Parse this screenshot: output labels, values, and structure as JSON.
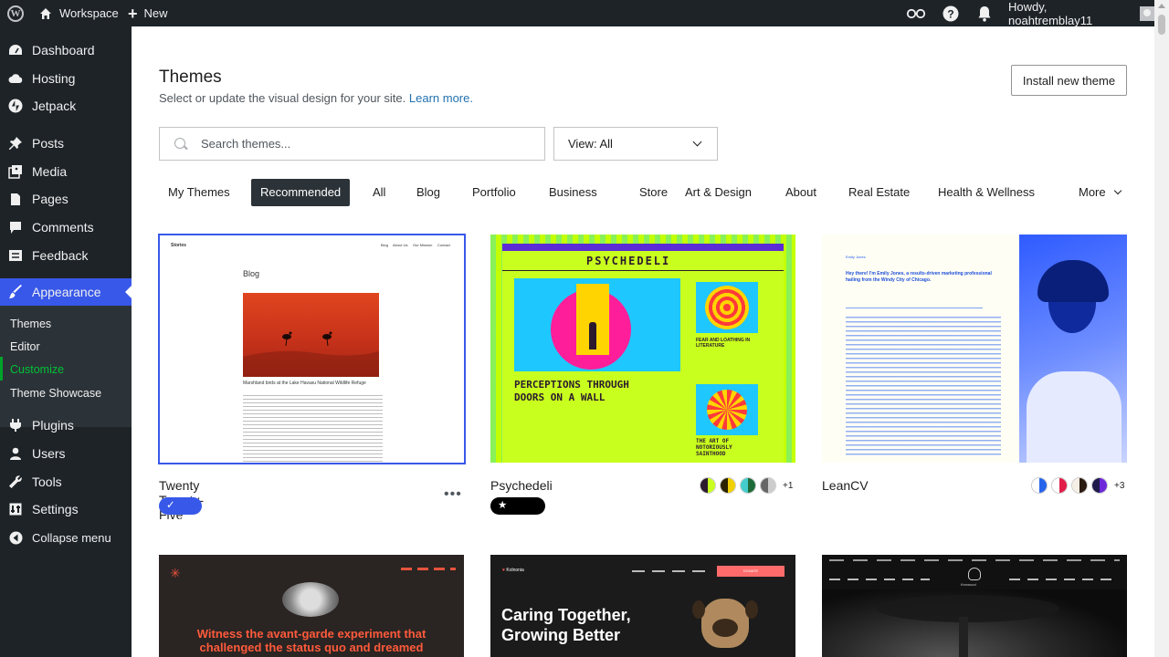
{
  "adminbar": {
    "site_name": "Workspace",
    "new_label": "New",
    "howdy": "Howdy, noahtremblay11"
  },
  "sidebar": {
    "items": [
      {
        "label": "Dashboard",
        "icon": "dashboard-icon"
      },
      {
        "label": "Hosting",
        "icon": "cloud-icon"
      },
      {
        "label": "Jetpack",
        "icon": "jetpack-icon"
      },
      {
        "label": "Posts",
        "icon": "pin-icon"
      },
      {
        "label": "Media",
        "icon": "media-icon"
      },
      {
        "label": "Pages",
        "icon": "page-icon"
      },
      {
        "label": "Comments",
        "icon": "comment-icon"
      },
      {
        "label": "Feedback",
        "icon": "feedback-icon"
      },
      {
        "label": "Appearance",
        "icon": "brush-icon"
      },
      {
        "label": "Plugins",
        "icon": "plugin-icon"
      },
      {
        "label": "Users",
        "icon": "users-icon"
      },
      {
        "label": "Tools",
        "icon": "wrench-icon"
      },
      {
        "label": "Settings",
        "icon": "settings-icon"
      },
      {
        "label": "Collapse menu",
        "icon": "collapse-icon"
      }
    ],
    "submenu": [
      "Themes",
      "Editor",
      "Customize",
      "Theme Showcase"
    ]
  },
  "header": {
    "title": "Themes",
    "subtitle": "Select or update the visual design for your site.",
    "learn_more": "Learn more.",
    "install_button": "Install new theme"
  },
  "search": {
    "placeholder": "Search themes..."
  },
  "view_select": {
    "value": "View: All"
  },
  "filters": [
    "My Themes",
    "Recommended",
    "All",
    "Blog",
    "Portfolio",
    "Business",
    "Store",
    "Art & Design",
    "About",
    "Real Estate",
    "Health & Wellness",
    "More"
  ],
  "active_filter": "Recommended",
  "themes": [
    {
      "name": "Twenty Twenty-Five",
      "badge": "Active"
    },
    {
      "name": "Psychedeli",
      "badge": "Upgrade",
      "more_styles": "+1"
    },
    {
      "name": "LeanCV",
      "more_styles": "+3"
    }
  ],
  "previews": {
    "stories": {
      "brand": "Stories",
      "nav": [
        "Blog",
        "About Us",
        "Our Mission",
        "Contact"
      ],
      "heading": "Blog",
      "caption": "Marshland birds at the Lake Havasu National Wildlife Refuge"
    },
    "psychedeli": {
      "title": "PSYCHEDELI",
      "h1": "PERCEPTIONS THROUGH DOORS ON A WALL",
      "h2": "FEAR AND LOATHING IN LITERATURE",
      "h3": "THE ART OF NOTORIOUSLY SAINTHOOD"
    },
    "leancv": {
      "name": "Emily Jones",
      "intro": "Hey there! I'm Emily Jones, a results-driven marketing professional hailing from the Windy City of Chicago."
    },
    "row2": [
      {
        "text": "Witness the avant-garde experiment that challenged the status quo and dreamed"
      },
      {
        "brand": "Kolnonia",
        "text": "Caring Together, Growing Better",
        "button": "DONATE"
      },
      {
        "brand": "Kenwood"
      }
    ]
  },
  "colors": {
    "accent": "#3858e9",
    "sidebar": "#1d2327",
    "customize": "#00a32a"
  }
}
